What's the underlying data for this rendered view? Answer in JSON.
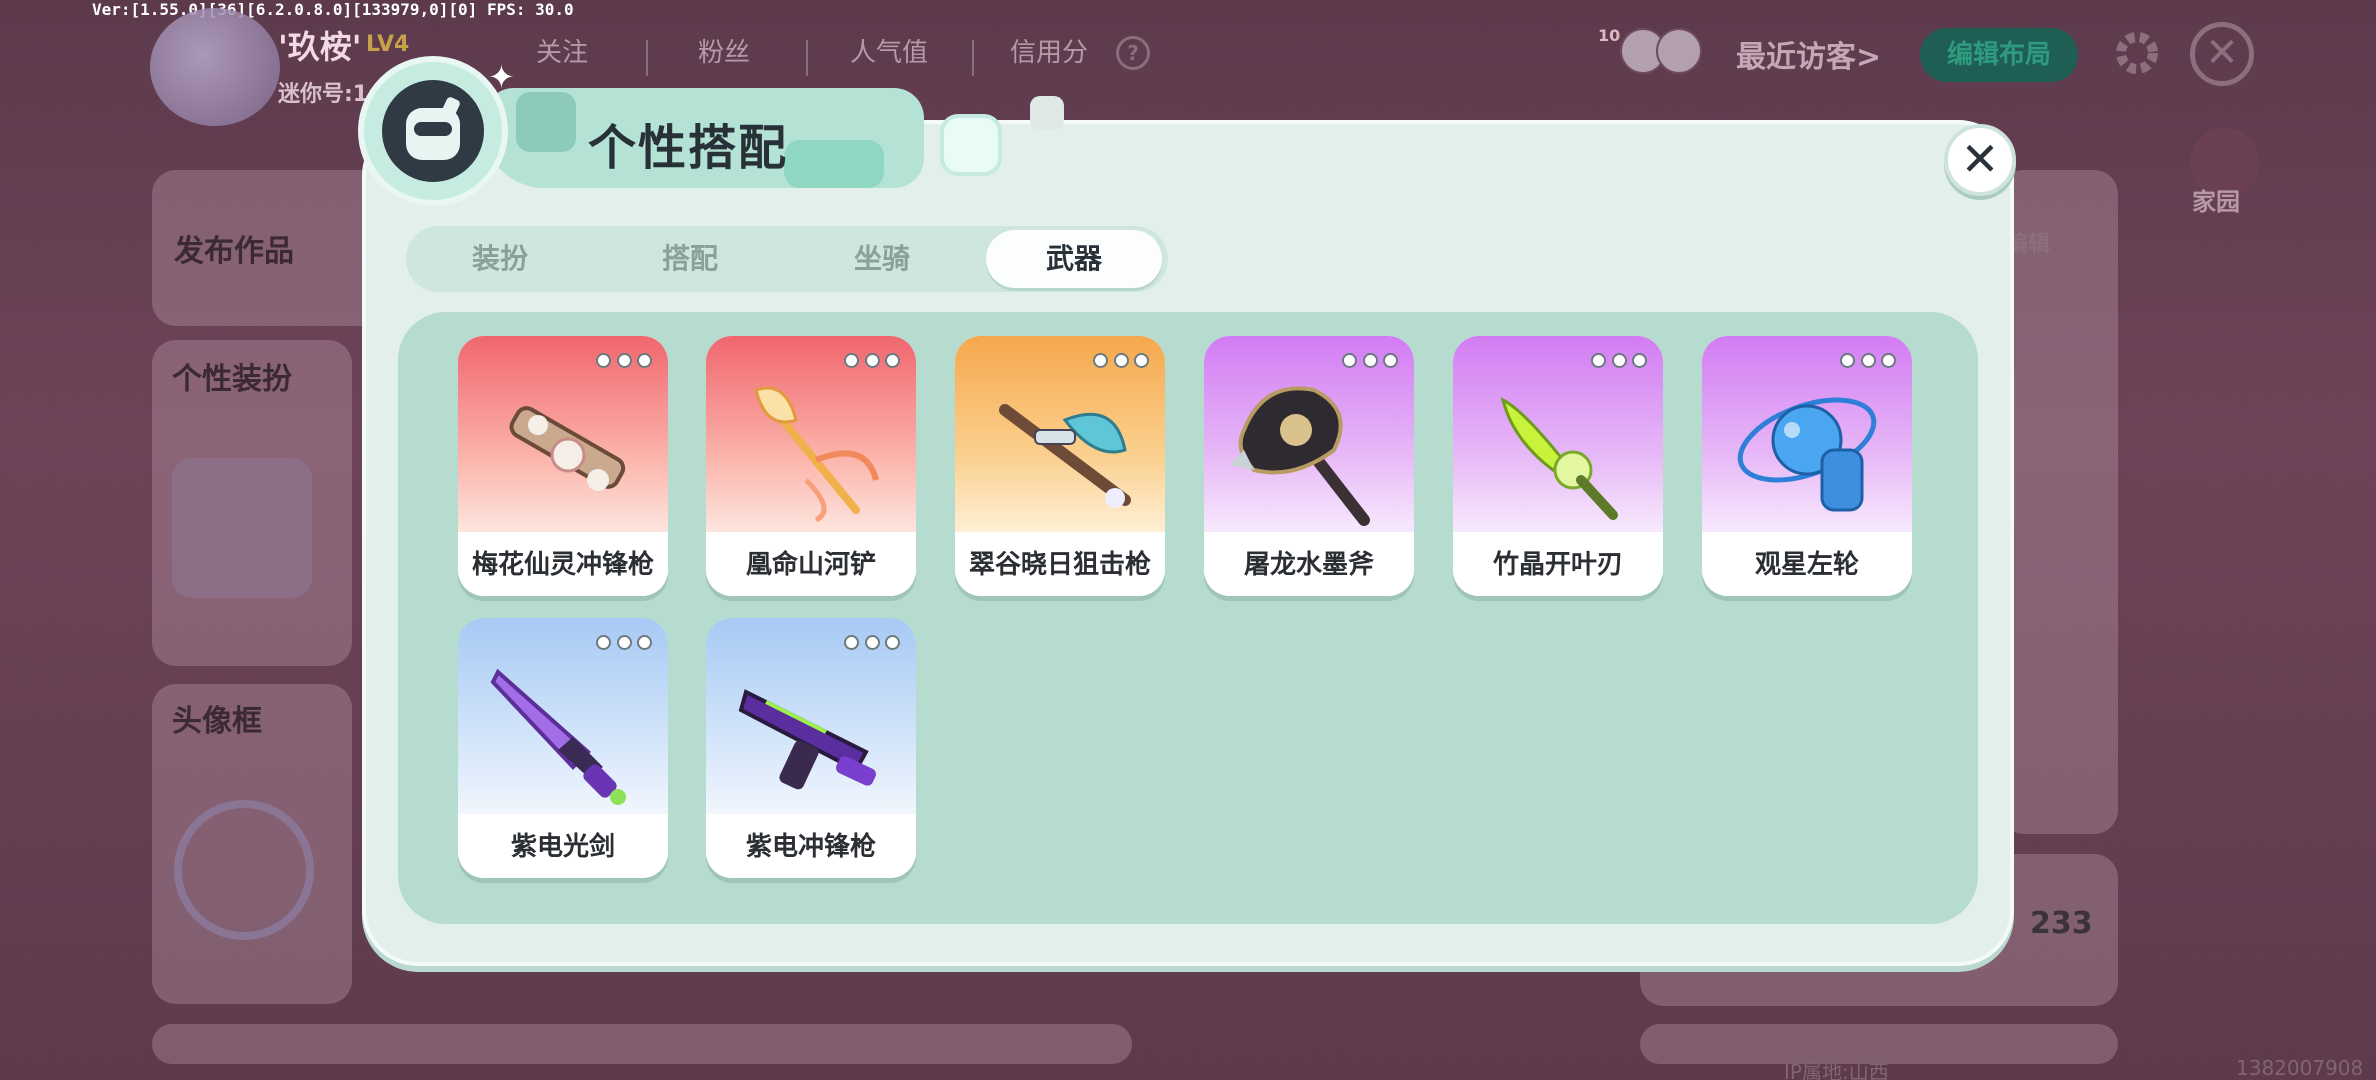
{
  "debug": {
    "version_text": "Ver:[1.55.0][36][6.2.0.8.0][133979,0][0] FPS: 30.0"
  },
  "profile": {
    "username": "'玖桉'",
    "level": "LV4",
    "mini_id_label": "迷你号:1",
    "stats": [
      {
        "label": "关注"
      },
      {
        "label": "粉丝"
      },
      {
        "label": "人气值"
      },
      {
        "label": "信用分"
      }
    ],
    "visitor_badge": "10",
    "recent_visitors": "最近访客>",
    "edit_layout": "编辑布局",
    "home_label": "家园",
    "sections": {
      "publish": "发布作品",
      "outfit": "个性装扮",
      "avatar_frame": "头像框"
    },
    "edit_right": "编辑",
    "count": "233",
    "ip_label": "IP属地:山西",
    "uid": "1382007908"
  },
  "modal": {
    "title": "个性搭配",
    "close_symbol": "✕",
    "tabs": [
      {
        "label": "装扮",
        "active": false
      },
      {
        "label": "搭配",
        "active": false
      },
      {
        "label": "坐骑",
        "active": false
      },
      {
        "label": "武器",
        "active": true
      }
    ],
    "items": [
      {
        "name": "梅花仙灵冲锋枪",
        "color": "red",
        "icon": "flower-gun-icon"
      },
      {
        "name": "凰命山河铲",
        "color": "red",
        "icon": "phoenix-spade-icon"
      },
      {
        "name": "翠谷晓日狙击枪",
        "color": "orange",
        "icon": "sniper-rifle-icon"
      },
      {
        "name": "屠龙水墨斧",
        "color": "purple",
        "icon": "dragon-axe-icon"
      },
      {
        "name": "竹晶开叶刃",
        "color": "purple",
        "icon": "crystal-blade-icon"
      },
      {
        "name": "观星左轮",
        "color": "purple",
        "icon": "star-revolver-icon"
      },
      {
        "name": "紫电光剑",
        "color": "blue",
        "icon": "purple-sword-icon"
      },
      {
        "name": "紫电冲锋枪",
        "color": "blue",
        "icon": "purple-smg-icon"
      }
    ]
  },
  "colors": {
    "accent": "#b4e3d6",
    "panel": "#e3efeb",
    "grid": "#b5dccf",
    "text_dark": "#283038"
  }
}
